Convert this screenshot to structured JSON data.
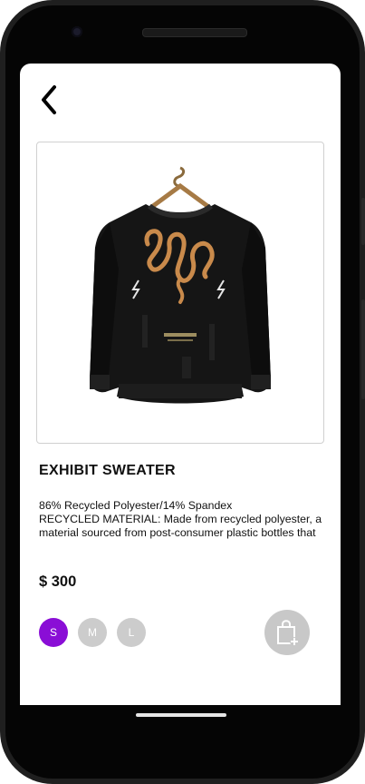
{
  "product": {
    "title": "EXHIBIT SWEATER",
    "description_line1": "86% Recycled Polyester/14% Spandex",
    "description_line2": "RECYCLED MATERIAL: Made from recycled polyester, a material sourced from post-consumer plastic bottles that",
    "price": "$ 300",
    "image_icon": "black-sweater-with-snake-print"
  },
  "sizes": [
    {
      "label": "S",
      "selected": true
    },
    {
      "label": "M",
      "selected": false
    },
    {
      "label": "L",
      "selected": false
    }
  ],
  "icons": {
    "back": "chevron-left-icon",
    "cart": "shopping-bag-add-icon"
  },
  "colors": {
    "accent": "#8a0ed6",
    "chip_inactive": "#cccccc",
    "cart_button": "#c8c8c8"
  }
}
